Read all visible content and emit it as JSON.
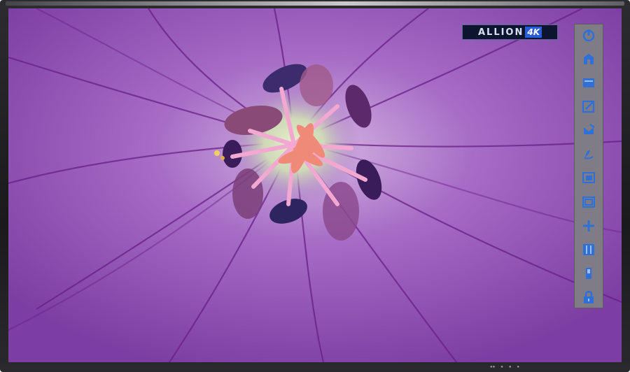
{
  "brand": {
    "text": "ALLION",
    "accent": "4K"
  },
  "toolbar": {
    "items": [
      {
        "name": "power-icon",
        "interactive": true
      },
      {
        "name": "input-source-icon",
        "interactive": true
      },
      {
        "name": "folder-icon",
        "interactive": true
      },
      {
        "name": "edit-icon",
        "interactive": true
      },
      {
        "name": "annotate-icon",
        "interactive": true
      },
      {
        "name": "pen-icon",
        "interactive": true
      },
      {
        "name": "screenshot-icon",
        "interactive": true
      },
      {
        "name": "window-icon",
        "interactive": true
      },
      {
        "name": "add-icon",
        "interactive": true
      },
      {
        "name": "grid-icon",
        "interactive": true
      },
      {
        "name": "volume-icon",
        "interactive": true
      },
      {
        "name": "lock-icon",
        "interactive": true
      }
    ]
  },
  "colors": {
    "toolbar_bg": "#7f7c86",
    "icon": "#2f6fd8",
    "screen_center": "#c9a4d8",
    "screen_edge": "#7a3c9e"
  }
}
